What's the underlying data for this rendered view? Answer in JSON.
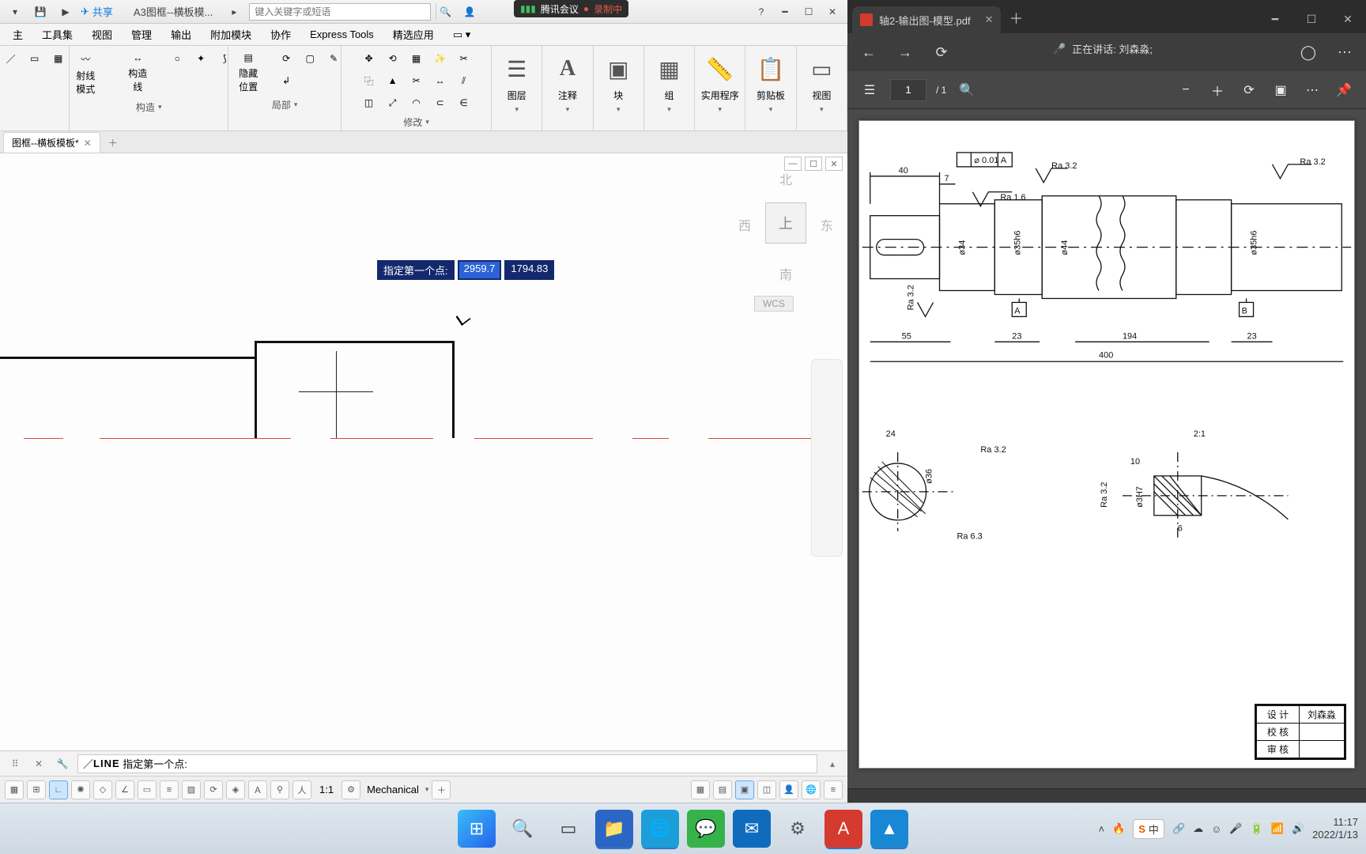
{
  "cad": {
    "doc_title": "A3图框--横板模...",
    "share": "共享",
    "search_placeholder": "键入关键字或短语",
    "meeting": {
      "app": "腾讯会议",
      "rec": "录制中"
    },
    "menus": [
      "主",
      "工具集",
      "视图",
      "管理",
      "输出",
      "附加模块",
      "协作",
      "Express Tools",
      "精选应用"
    ],
    "ribbon": {
      "draw_label": "构造",
      "rayline": "射线\n模式",
      "construct_line": "构造\n线",
      "hide_label": "隐藏\n位置",
      "partial": "局部",
      "modify": "修改",
      "layer": "图层",
      "annotate": "注释",
      "block": "块",
      "group": "组",
      "utility": "实用程序",
      "clipboard": "剪贴板",
      "view": "视图"
    },
    "doc_tab": "图框--横板模板*",
    "viewcube": {
      "n": "北",
      "s": "南",
      "w": "西",
      "e": "东",
      "top": "上",
      "wcs": "WCS"
    },
    "dyn": {
      "label": "指定第一个点:",
      "x": "2959.7",
      "y": "1794.83"
    },
    "cmd": {
      "keyword": "LINE",
      "prompt": "指定第一个点:"
    },
    "status": {
      "scale": "1:1",
      "style": "Mechanical"
    }
  },
  "pdf": {
    "tab_title": "轴2-输出图-模型.pdf",
    "speaking": "正在讲话: 刘森淼;",
    "page_current": "1",
    "page_total": "/ 1",
    "drawing": {
      "overall_len": "400",
      "dims": [
        "40",
        "7",
        "55",
        "23",
        "23",
        "194",
        "10",
        "6",
        "24"
      ],
      "dia": [
        "ø34",
        "ø35h6",
        "ø44",
        "ø35h6",
        "ø36",
        "ø3H7"
      ],
      "tol": "⌀ 0.01 A",
      "ratio": "2:1",
      "ra": [
        "Ra 3.2",
        "Ra 1.6",
        "Ra 3.2",
        "Ra 3.2",
        "Ra 3.2",
        "Ra 6.3",
        "Ra 3.2"
      ],
      "datum": [
        "A",
        "B"
      ],
      "title_rows": [
        [
          "设 计",
          "刘森淼"
        ],
        [
          "校 核",
          ""
        ],
        [
          "审 核",
          ""
        ]
      ]
    }
  },
  "taskbar": {
    "ime": "中",
    "time": "11:17",
    "date": "2022/1/13"
  }
}
